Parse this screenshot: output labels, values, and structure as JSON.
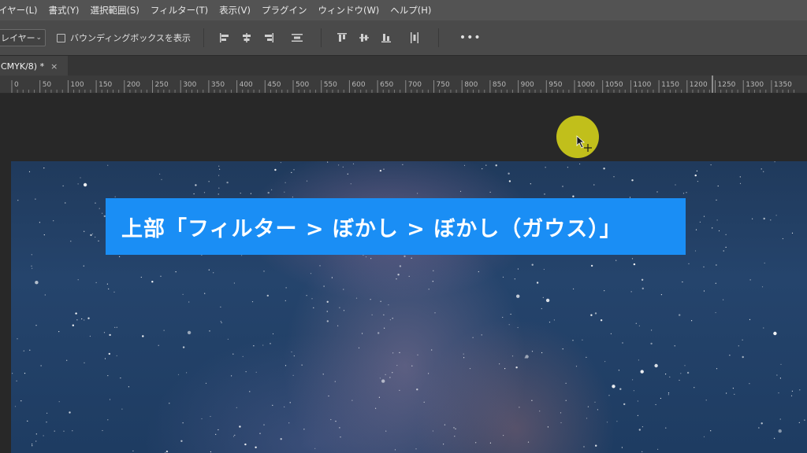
{
  "menubar": {
    "items": [
      "イヤー(L)",
      "書式(Y)",
      "選択範囲(S)",
      "フィルター(T)",
      "表示(V)",
      "プラグイン",
      "ウィンドウ(W)",
      "ヘルプ(H)"
    ]
  },
  "options": {
    "layer_select": "レイヤー",
    "bbox_label": "バウンディングボックスを表示",
    "bbox_checked": false,
    "more_label": "•••"
  },
  "document": {
    "tab_label": "CMYK/8) *",
    "close_glyph": "×"
  },
  "ruler": {
    "labels": [
      "0",
      "50",
      "100",
      "150",
      "200",
      "250",
      "300",
      "350",
      "400",
      "450",
      "500",
      "550",
      "600",
      "650",
      "700",
      "750",
      "800",
      "850",
      "900",
      "950",
      "1000",
      "1050",
      "1100",
      "1150",
      "1200",
      "1250",
      "1300",
      "1350"
    ]
  },
  "caption": {
    "text": "上部「フィルター > ぼかし > ぼかし（ガウス）」"
  },
  "colors": {
    "caption_bg": "#1a8ef5",
    "cursor_highlight": "#cecc1a",
    "menubar_bg": "#535353",
    "workspace_bg": "#282828"
  },
  "icons": [
    "align-left-icon",
    "align-hcenter-icon",
    "align-right-icon",
    "distribute-horizontal-icon",
    "align-top-icon",
    "align-vcenter-icon",
    "align-bottom-icon",
    "distribute-vertical-icon",
    "more-icon",
    "close-icon",
    "chevron-down-icon",
    "cursor-arrow-icon"
  ]
}
